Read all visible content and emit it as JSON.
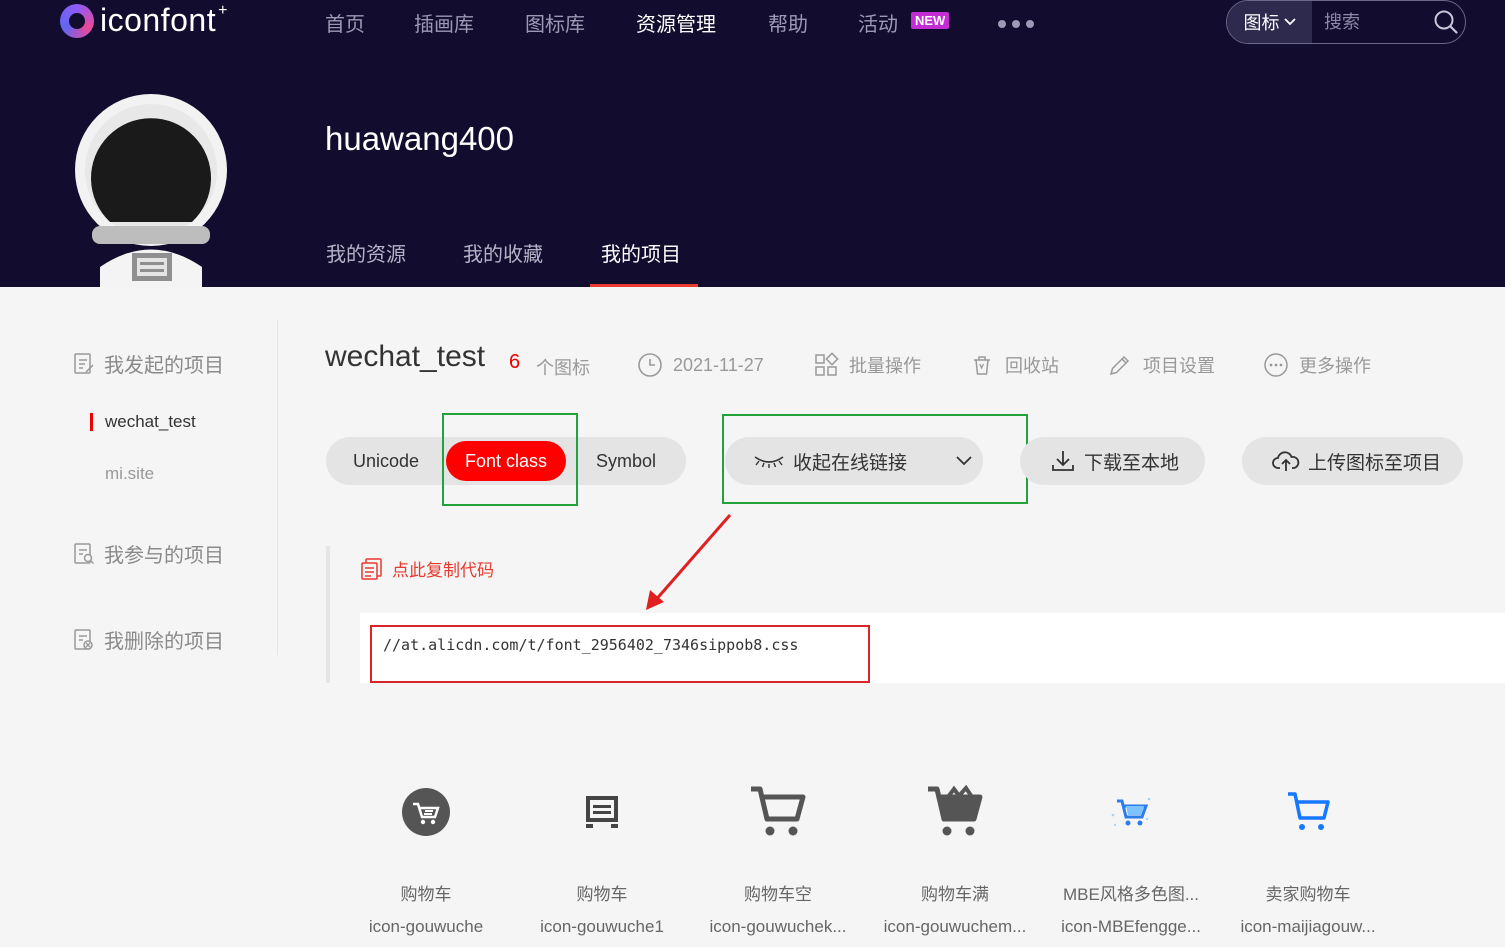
{
  "brand": {
    "name": "iconfont",
    "suffix": "+"
  },
  "nav": {
    "items": [
      "首页",
      "插画库",
      "图标库",
      "资源管理",
      "帮助",
      "活动"
    ],
    "active": "资源管理",
    "badge": "NEW"
  },
  "search": {
    "type": "图标",
    "placeholder": "搜索"
  },
  "profile": {
    "username": "huawang400",
    "tabs": [
      "我的资源",
      "我的收藏",
      "我的项目"
    ],
    "active_tab": "我的项目"
  },
  "sidebar": {
    "created_heading": "我发起的项目",
    "projects": [
      "wechat_test",
      "mi.site"
    ],
    "active_project": "wechat_test",
    "joined_heading": "我参与的项目",
    "deleted_heading": "我删除的项目"
  },
  "project": {
    "name": "wechat_test",
    "icon_count": "6",
    "icon_count_label": "个图标",
    "date": "2021-11-27",
    "batch": "批量操作",
    "trash": "回收站",
    "settings": "项目设置",
    "more": "更多操作"
  },
  "formats": {
    "unicode": "Unicode",
    "font_class": "Font class",
    "symbol": "Symbol",
    "active": "Font class"
  },
  "actions": {
    "collapse_link": "收起在线链接",
    "download": "下载至本地",
    "upload": "上传图标至项目"
  },
  "code": {
    "copy_label": "点此复制代码",
    "url": "//at.alicdn.com/t/font_2956402_7346sippob8.css"
  },
  "icons": [
    {
      "name": "购物车",
      "code": "icon-gouwuche",
      "glyph": "cart-circle-icon"
    },
    {
      "name": "购物车",
      "code": "icon-gouwuche1",
      "glyph": "cart-box-icon"
    },
    {
      "name": "购物车空",
      "code": "icon-gouwuchek...",
      "glyph": "cart-empty-icon"
    },
    {
      "name": "购物车满",
      "code": "icon-gouwuchem...",
      "glyph": "cart-full-icon"
    },
    {
      "name": "MBE风格多色图...",
      "code": "icon-MBEfengge...",
      "glyph": "cart-multicolor-icon"
    },
    {
      "name": "卖家购物车",
      "code": "icon-maijiagouw...",
      "glyph": "cart-outline-blue-icon"
    }
  ],
  "colors": {
    "header_bg": "#120c2e",
    "accent_red": "#ff0000",
    "annotation_green": "#22a33a",
    "annotation_red": "#d9242a"
  }
}
